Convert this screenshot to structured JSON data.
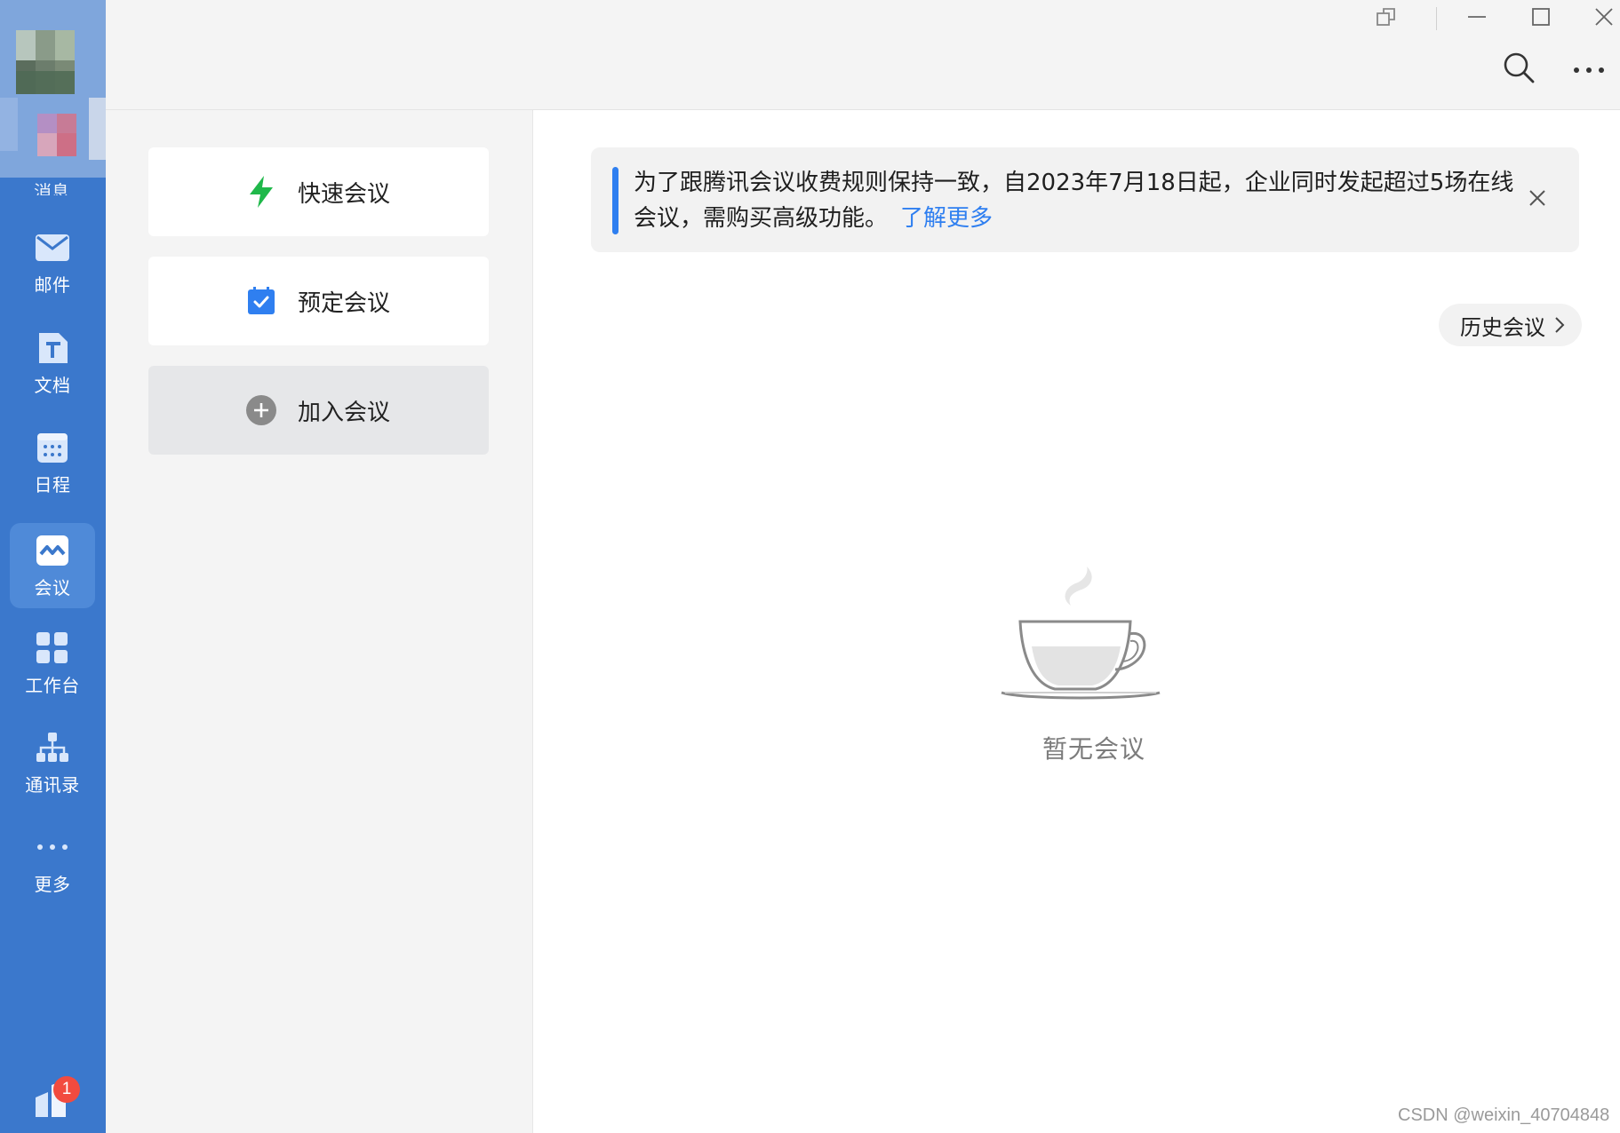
{
  "sidebar": {
    "partial_label": "消息",
    "items": [
      {
        "id": "mail",
        "label": "邮件",
        "icon": "mail-icon"
      },
      {
        "id": "docs",
        "label": "文档",
        "icon": "document-icon"
      },
      {
        "id": "schedule",
        "label": "日程",
        "icon": "calendar-icon"
      },
      {
        "id": "meeting",
        "label": "会议",
        "icon": "meeting-icon",
        "active": true
      },
      {
        "id": "workbench",
        "label": "工作台",
        "icon": "grid-icon"
      },
      {
        "id": "contacts",
        "label": "通讯录",
        "icon": "org-chart-icon"
      },
      {
        "id": "more",
        "label": "更多",
        "icon": "more-dots-icon"
      }
    ],
    "bottom_badge": "1",
    "colors": {
      "bg": "#3b78cc",
      "active": "#4f8ad8"
    }
  },
  "titlebar": {
    "buttons": [
      "popout-icon",
      "minimize-icon",
      "maximize-icon",
      "close-icon"
    ]
  },
  "toolbar": {
    "buttons": [
      "search-icon",
      "more-horizontal-icon"
    ]
  },
  "actions": [
    {
      "id": "quick",
      "label": "快速会议",
      "icon": "lightning-icon",
      "color": "#1fb84a"
    },
    {
      "id": "schedule",
      "label": "预定会议",
      "icon": "calendar-check-icon",
      "color": "#2f7ff0"
    },
    {
      "id": "join",
      "label": "加入会议",
      "icon": "plus-circle-icon",
      "color": "#8a8a8a"
    }
  ],
  "notice": {
    "text": "为了跟腾讯会议收费规则保持一致，自2023年7月18日起，企业同时发起超过5场在线会议，需购买高级功能。",
    "link": "了解更多",
    "accent": "#2f7ff0"
  },
  "history_button": "历史会议",
  "empty_state": {
    "text": "暂无会议",
    "icon": "coffee-cup-icon"
  },
  "watermark": "CSDN @weixin_40704848"
}
